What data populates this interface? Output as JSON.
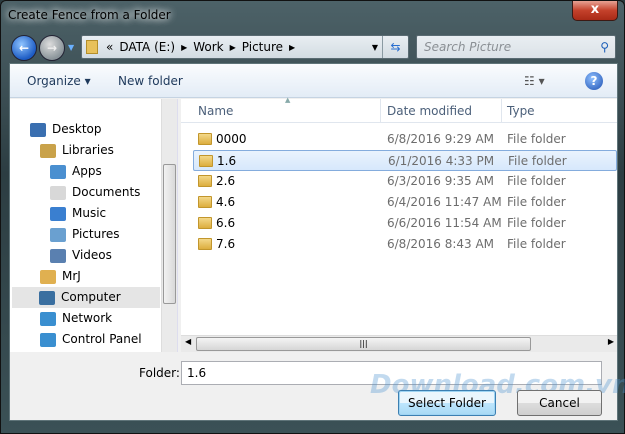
{
  "window": {
    "title": "Create Fence from a Folder",
    "close": "x"
  },
  "address": {
    "overflow": "«",
    "crumbs": [
      "DATA (E:)",
      "Work",
      "Picture"
    ]
  },
  "search": {
    "placeholder": "Search Picture"
  },
  "toolbar": {
    "organize": "Organize ▾",
    "new_folder": "New folder",
    "views": "☷ ▾",
    "help": "?"
  },
  "nav": {
    "items": [
      {
        "label": "Desktop",
        "color": "#3a6fb0"
      },
      {
        "label": "Libraries",
        "color": "#c9a24a"
      },
      {
        "label": "Apps",
        "color": "#4a8fd0"
      },
      {
        "label": "Documents",
        "color": "#d8d8d8"
      },
      {
        "label": "Music",
        "color": "#3a7fd0"
      },
      {
        "label": "Pictures",
        "color": "#6aa0d0"
      },
      {
        "label": "Videos",
        "color": "#5a80b0"
      },
      {
        "label": "MrJ",
        "color": "#e0b050"
      },
      {
        "label": "Computer",
        "color": "#3a6fa0"
      },
      {
        "label": "Network",
        "color": "#3a8fd0"
      },
      {
        "label": "Control Panel",
        "color": "#3a8fd0"
      }
    ]
  },
  "list": {
    "columns": [
      "Name",
      "Date modified",
      "Type"
    ],
    "rows": [
      {
        "name": "0000",
        "date": "6/8/2016 9:29 AM",
        "type": "File folder"
      },
      {
        "name": "1.6",
        "date": "6/1/2016 4:33 PM",
        "type": "File folder"
      },
      {
        "name": "2.6",
        "date": "6/3/2016 9:35 AM",
        "type": "File folder"
      },
      {
        "name": "4.6",
        "date": "6/4/2016 11:47 AM",
        "type": "File folder"
      },
      {
        "name": "6.6",
        "date": "6/6/2016 11:54 AM",
        "type": "File folder"
      },
      {
        "name": "7.6",
        "date": "6/8/2016 8:43 AM",
        "type": "File folder"
      }
    ]
  },
  "footer": {
    "folder_label": "Folder:",
    "folder_value": "1.6",
    "select": "Select Folder",
    "cancel": "Cancel"
  },
  "watermark": "Download.com.vn"
}
